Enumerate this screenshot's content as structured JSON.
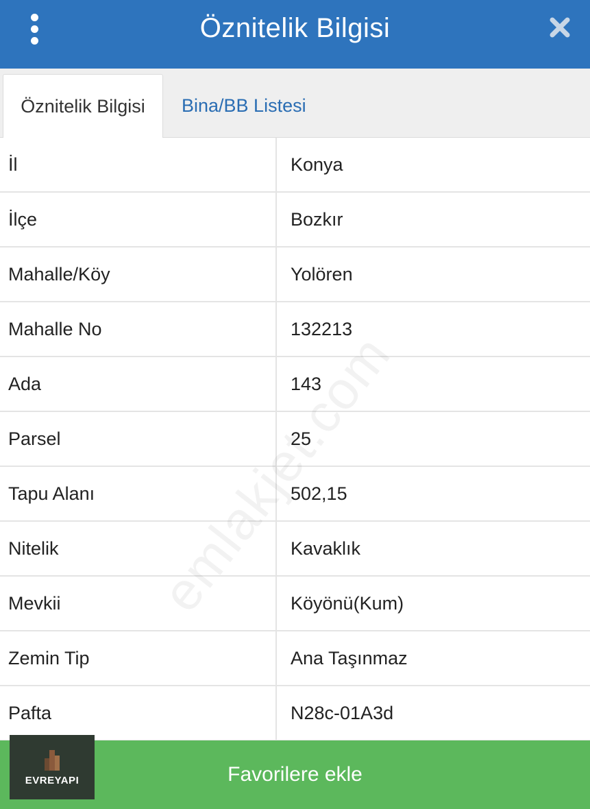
{
  "header": {
    "title": "Öznitelik Bilgisi",
    "menu_icon": "more-vertical-icon",
    "close_icon": "close-icon",
    "color": "#2e74bd"
  },
  "tabs": [
    {
      "label": "Öznitelik Bilgisi",
      "active": true
    },
    {
      "label": "Bina/BB Listesi",
      "active": false
    }
  ],
  "rows": [
    {
      "label": "İl",
      "value": "Konya"
    },
    {
      "label": "İlçe",
      "value": "Bozkır"
    },
    {
      "label": "Mahalle/Köy",
      "value": "Yolören"
    },
    {
      "label": "Mahalle No",
      "value": "132213"
    },
    {
      "label": "Ada",
      "value": "143"
    },
    {
      "label": "Parsel",
      "value": "25"
    },
    {
      "label": "Tapu Alanı",
      "value": "502,15"
    },
    {
      "label": "Nitelik",
      "value": "Kavaklık"
    },
    {
      "label": "Mevkii",
      "value": "Köyönü(Kum)"
    },
    {
      "label": "Zemin Tip",
      "value": "Ana Taşınmaz"
    },
    {
      "label": "Pafta",
      "value": "N28c-01A3d"
    }
  ],
  "watermark": "emlakjet.com",
  "footer": {
    "button_label": "Favorilere ekle",
    "color": "#5cb85c"
  },
  "logo": {
    "text": "EVREYAPI",
    "icon": "building-logo-icon"
  }
}
